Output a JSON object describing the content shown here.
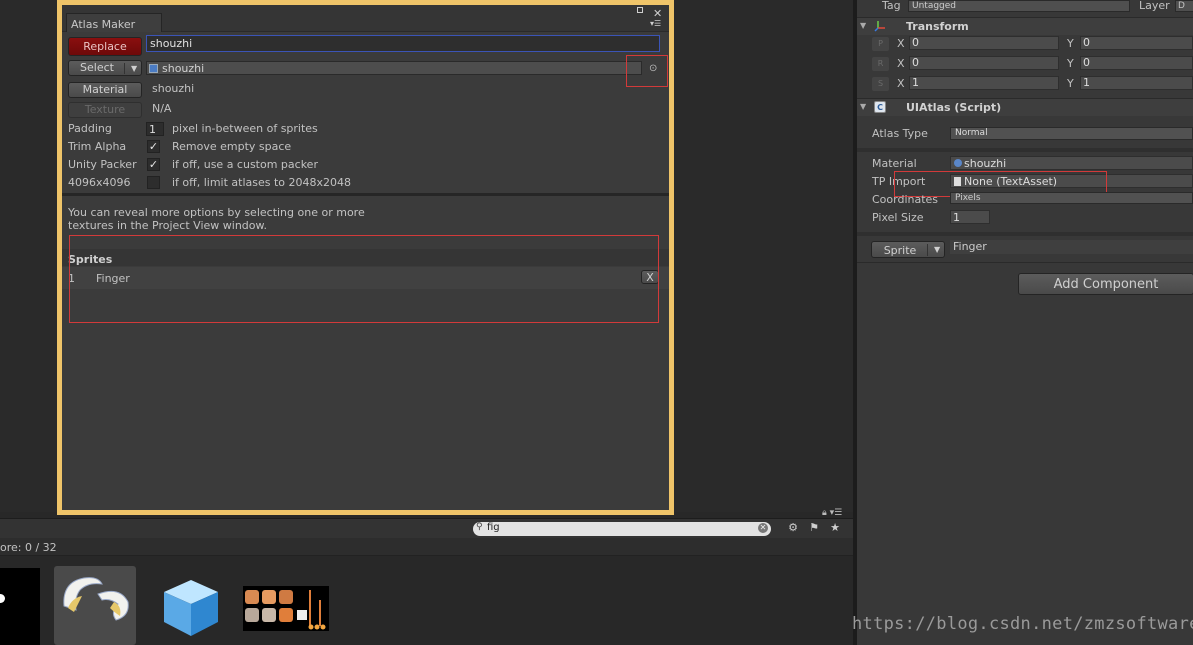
{
  "atlas_maker": {
    "tab_title": "Atlas Maker",
    "replace_label": "Replace",
    "name_value": "shouzhi",
    "select_label": "Select",
    "atlas_field": "shouzhi",
    "material_label": "Material",
    "material_value": "shouzhi",
    "texture_label": "Texture",
    "texture_value": "N/A",
    "padding_label": "Padding",
    "padding_value": "1",
    "padding_desc": "pixel in-between of sprites",
    "trim_label": "Trim Alpha",
    "trim_desc": "Remove empty space",
    "packer_label": "Unity Packer",
    "packer_desc": "if off, use a custom packer",
    "size_label": "4096x4096",
    "size_desc": "if off, limit atlases to 2048x2048",
    "info_text": "You can reveal more options by selecting one or more textures in the Project View window.",
    "sprites_header": "Sprites",
    "sprites": [
      {
        "index": "1",
        "name": "Finger"
      }
    ],
    "remove_label": "X"
  },
  "project": {
    "search_value": "fig",
    "status_text": "ore: 0 / 32"
  },
  "inspector": {
    "tag_label": "Tag",
    "tag_value": "Untagged",
    "layer_label": "Layer",
    "layer_value": "D",
    "transform_title": "Transform",
    "transform_rows": [
      {
        "btn": "P",
        "x": "0",
        "y": "0"
      },
      {
        "btn": "R",
        "x": "0",
        "y": "0"
      },
      {
        "btn": "S",
        "x": "1",
        "y": "1"
      }
    ],
    "x_axis": "X",
    "y_axis": "Y",
    "script_title": "UIAtlas (Script)",
    "atlas_type_label": "Atlas Type",
    "atlas_type_value": "Normal",
    "material_label": "Material",
    "material_value": "shouzhi",
    "tp_import_label": "TP Import",
    "tp_import_value": "None (TextAsset)",
    "coordinates_label": "Coordinates",
    "coordinates_value": "Pixels",
    "pixel_size_label": "Pixel Size",
    "pixel_size_value": "1",
    "sprite_btn_label": "Sprite",
    "sprite_value": "Finger",
    "add_component_label": "Add Component"
  },
  "watermark": "https://blog.csdn.net/zmzsoftware",
  "colors": {
    "highlight_border": "#efc469",
    "annotation_red": "#d23a3a",
    "replace_red": "#8a0f0f"
  }
}
